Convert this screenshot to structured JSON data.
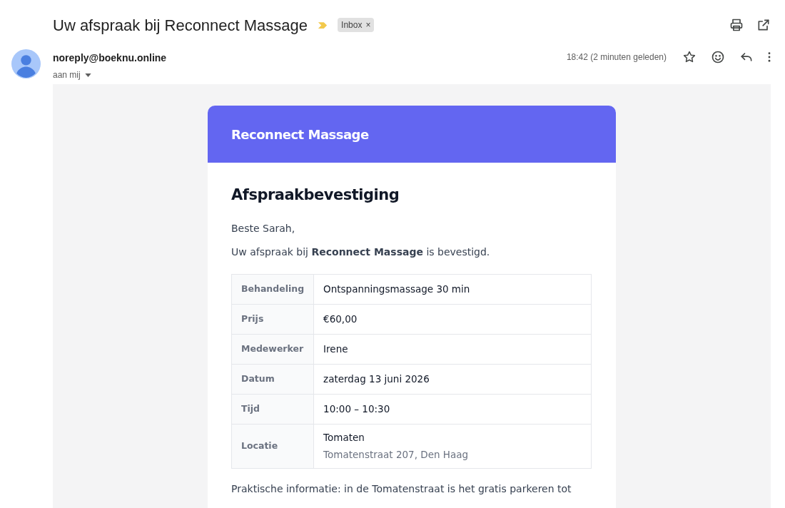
{
  "subject": "Uw afspraak bij Reconnect Massage",
  "label": {
    "text": "Inbox",
    "remove": "×"
  },
  "sender": {
    "address": "noreply@boeknu.online",
    "recipient": "aan mij"
  },
  "time": "18:42 (2 minuten geleden)",
  "starred": false,
  "email": {
    "brand": "Reconnect Massage",
    "heading": "Afspraakbevestiging",
    "greeting": "Beste Sarah,",
    "intro": "Uw afspraak bij **Reconnect Massage** is bevestigd.",
    "details": [
      {
        "label": "Behandeling",
        "value": "Ontspanningsmassage 30 min"
      },
      {
        "label": "Prijs",
        "value": "€60,00"
      },
      {
        "label": "Medewerker",
        "value": "Irene"
      },
      {
        "label": "Datum",
        "value": "zaterdag 13 juni 2026"
      },
      {
        "label": "Tijd",
        "value": "10:00 – 10:30"
      },
      {
        "label": "Locatie",
        "value": "Tomaten",
        "note": "Tomatenstraat 207, Den Haag"
      }
    ],
    "footer": "Praktische informatie: in de Tomatenstraat is het gratis parkeren tot"
  }
}
